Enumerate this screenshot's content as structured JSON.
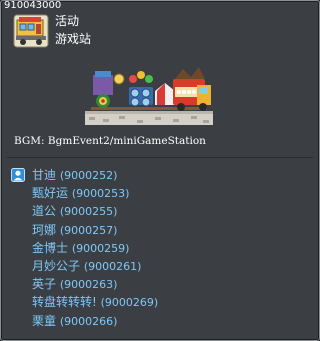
{
  "map": {
    "id": "910043000",
    "region": "活动",
    "name": "游戏站",
    "bgm_label": "BGM: BgmEvent2/miniGameStation"
  },
  "npcs": [
    {
      "name": "甘迪",
      "id": "(9000252)"
    },
    {
      "name": "甄好运",
      "id": "(9000253)"
    },
    {
      "name": "道公",
      "id": "(9000255)"
    },
    {
      "name": "珂娜",
      "id": "(9000257)"
    },
    {
      "name": "金博士",
      "id": "(9000259)"
    },
    {
      "name": "月妙公子",
      "id": "(9000261)"
    },
    {
      "name": "英子",
      "id": "(9000263)"
    },
    {
      "name": "转盘转转转!",
      "id": "(9000269)"
    },
    {
      "name": "栗童",
      "id": "(9000266)"
    }
  ],
  "icons": {
    "map_icon": "train-station-icon",
    "npc_marker": "npc-marker-icon"
  },
  "colors": {
    "panel_bg": "#3b3f43",
    "npc_text": "#7ec7f8",
    "text": "#ffffff"
  }
}
